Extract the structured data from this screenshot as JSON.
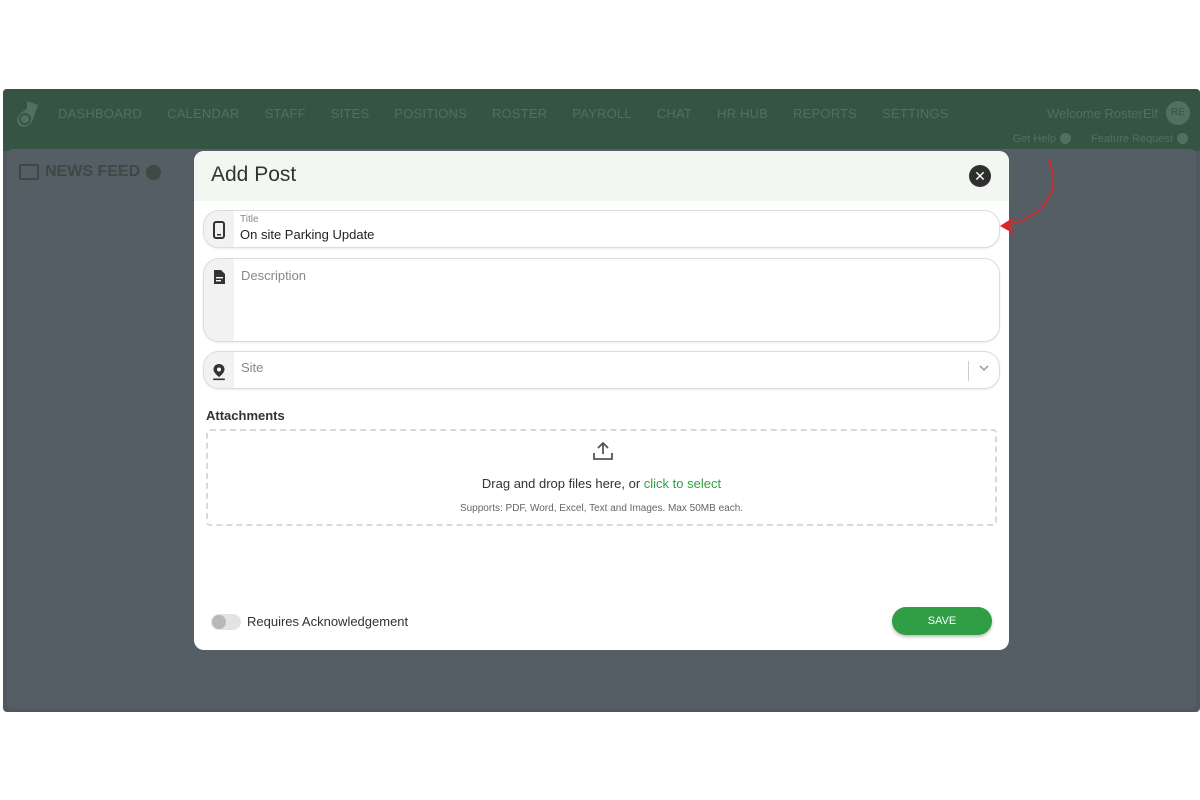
{
  "nav": {
    "items": [
      "DASHBOARD",
      "CALENDAR",
      "STAFF",
      "SITES",
      "POSITIONS",
      "ROSTER",
      "PAYROLL",
      "CHAT",
      "HR HUB",
      "REPORTS",
      "SETTINGS"
    ],
    "welcome": "Welcome RosterElf",
    "avatar_initials": "RE",
    "get_help": "Get Help",
    "feature_request": "Feature Request"
  },
  "page": {
    "section_title": "NEWS FEED"
  },
  "modal": {
    "title": "Add Post",
    "title_field": {
      "label": "Title",
      "value": "On site Parking Update"
    },
    "description_field": {
      "placeholder": "Description"
    },
    "site_field": {
      "placeholder": "Site"
    },
    "attachments": {
      "label": "Attachments",
      "drop_text": "Drag and drop files here, or ",
      "select_link": "click to select",
      "supports": "Supports: PDF, Word, Excel, Text and Images. Max 50MB each."
    },
    "acknowledgement_label": "Requires Acknowledgement",
    "acknowledgement_on": false,
    "save_label": "SAVE"
  },
  "colors": {
    "accent": "#2f9e44",
    "header_bg": "#f2f8f1",
    "topbar": "#365444",
    "annotation_arrow": "#e02424"
  }
}
